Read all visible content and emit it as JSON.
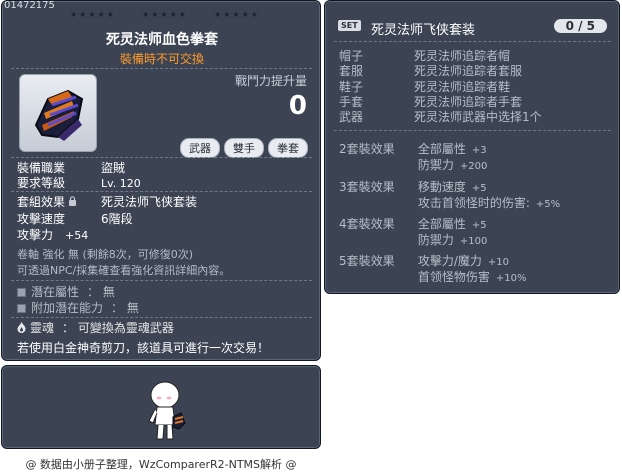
{
  "item_id": "01472175",
  "item": {
    "name": "死灵法师血色拳套",
    "trade_note": "裝備時不可交換",
    "power_label": "戰鬥力提升量",
    "power_value": "0",
    "tags": [
      "武器",
      "雙手",
      "拳套"
    ],
    "job_label": "裝備職業",
    "job_value": "盜賊",
    "level_label": "要求等級",
    "level_value": "Lv. 120",
    "set_label": "套組效果",
    "set_value": "死灵法师飞侠套装",
    "speed_label": "攻擊速度",
    "speed_value": "6階段",
    "attack_label": "攻擊力",
    "attack_value": "+54",
    "upgrade_text": "卷軸 強化 無 (剩餘8次，可修復0次)",
    "upgrade_hint": "可透過NPC/採集確查看強化資訊詳細內容。",
    "potential_label": "潛在屬性",
    "potential_value": "： 無",
    "add_potential_label": "附加潛在能力",
    "add_potential_value": "： 無",
    "soul_label": "靈魂",
    "soul_value": "： 可變換為靈魂武器",
    "footnote": "若使用白金神奇剪刀，該道具可進行一次交易！"
  },
  "set_panel": {
    "badge": "SET",
    "title": "死灵法师飞侠套装",
    "count": "0 / 5",
    "parts": [
      {
        "slot": "帽子",
        "name": "死灵法师追踪者帽"
      },
      {
        "slot": "套服",
        "name": "死灵法师追踪者套服"
      },
      {
        "slot": "鞋子",
        "name": "死灵法师追踪者鞋"
      },
      {
        "slot": "手套",
        "name": "死灵法师追踪者手套"
      },
      {
        "slot": "武器",
        "name": "死灵法师武器中选择1个"
      }
    ],
    "effects": [
      {
        "label": "2套裝效果",
        "lines": [
          {
            "stat": "全部屬性",
            "val": "+3"
          },
          {
            "stat": "防禦力",
            "val": "+200"
          }
        ]
      },
      {
        "label": "3套裝效果",
        "lines": [
          {
            "stat": "移動速度",
            "val": "+5"
          },
          {
            "stat": "攻击首领怪时的伤害:",
            "val": "+5%"
          }
        ]
      },
      {
        "label": "4套裝效果",
        "lines": [
          {
            "stat": "全部屬性",
            "val": "+5"
          },
          {
            "stat": "防禦力",
            "val": "+100"
          }
        ]
      },
      {
        "label": "5套裝效果",
        "lines": [
          {
            "stat": "攻擊力/魔力",
            "val": "+10"
          },
          {
            "stat": "首领怪物伤害",
            "val": "+10%"
          }
        ]
      }
    ]
  },
  "credits": "@ 数据由小册子整理，WzComparerR2-NTMS解析 @",
  "colors": {
    "panel_bg": "#3c4454",
    "trade_note": "#ff9a2a",
    "text_main": "#ffffff",
    "text_dim": "#b7bec8"
  }
}
